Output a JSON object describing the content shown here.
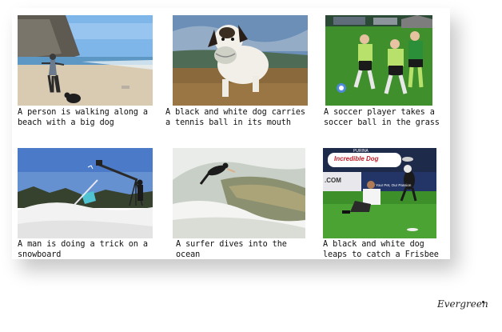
{
  "captions": [
    "A person is walking along a\nbeach with a big dog",
    "A black and white dog carries\na tennis ball in its mouth",
    "A soccer player takes a\nsoccer ball in the grass",
    "A man is doing a trick on a\nsnowboard",
    "A surfer dives into the\nocean",
    "A black and white dog\nleaps to catch a Frisbee"
  ],
  "images": [
    {
      "name": "beach-dog-photo",
      "sky": "#7fb6ea",
      "ground": "#d9cbb1"
    },
    {
      "name": "dog-tennis-ball-photo",
      "sky": "#6c8fb8",
      "ground": "#8a6a3c"
    },
    {
      "name": "soccer-players-photo",
      "sky": "#2f6a22",
      "ground": "#3f8f2c"
    },
    {
      "name": "snowboard-trick-photo",
      "sky": "#4a7ac8",
      "ground": "#f2f2f2"
    },
    {
      "name": "surfer-wave-photo",
      "sky": "#e9ece8",
      "ground": "#8a9070"
    },
    {
      "name": "dog-frisbee-photo",
      "sky": "#ffffff",
      "ground": "#3d8f2a"
    }
  ],
  "banners": {
    "brand": "PURINA",
    "title": "Incredible Dog",
    "sub": "Your Pet, Our Passion",
    "site": ".COM"
  },
  "logo": "Evergreen"
}
